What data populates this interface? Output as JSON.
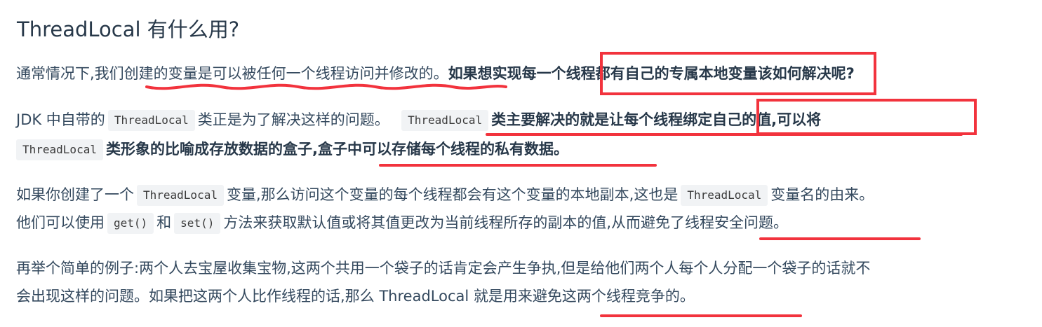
{
  "heading": "ThreadLocal 有什么用?",
  "p1": {
    "text": "通常情况下,我们创建的变量是可以被任何一个线程访问并修改的。",
    "bold": "如果想实现每一个线程都有自己的专属本地变量该如何解决呢?"
  },
  "p2": {
    "l1_a": "JDK 中自带的",
    "l1_code1": "ThreadLocal",
    "l1_b": "类正是为了解决这样的问题。",
    "l1_code2": "ThreadLocal",
    "l1_bold": "类主要解决的就是让每个线程绑定自己的值,可以将",
    "l2_code": "ThreadLocal",
    "l2_bold": "类形象的比喻成存放数据的盒子,盒子中可以存储每个线程的私有数据。"
  },
  "p3": {
    "l1_a": "如果你创建了一个",
    "l1_code1": "ThreadLocal",
    "l1_b": "变量,那么访问这个变量的每个线程都会有这个变量的本地副本,这也是",
    "l1_code2": "ThreadLocal",
    "l1_c": "变量名的由来。",
    "l2_a": "他们可以使用",
    "l2_code1": "get()",
    "l2_b": "和",
    "l2_code2": "set()",
    "l2_c": "方法来获取默认值或将其值更改为当前线程所存的副本的值,从而避免了线程安全问题。"
  },
  "p4": {
    "l1": "再举个简单的例子:两个人去宝屋收集宝物,这两个共用一个袋子的话肯定会产生争执,但是给他们两个人每个人分配一个袋子的话就不",
    "l2": "会出现这样的问题。如果把这两个人比作线程的话,那么 ThreadLocal 就是用来避免这两个线程竞争的。"
  },
  "colors": {
    "annotation": "#f2333d",
    "text": "#34495e",
    "code_bg": "#f1f3f5"
  }
}
